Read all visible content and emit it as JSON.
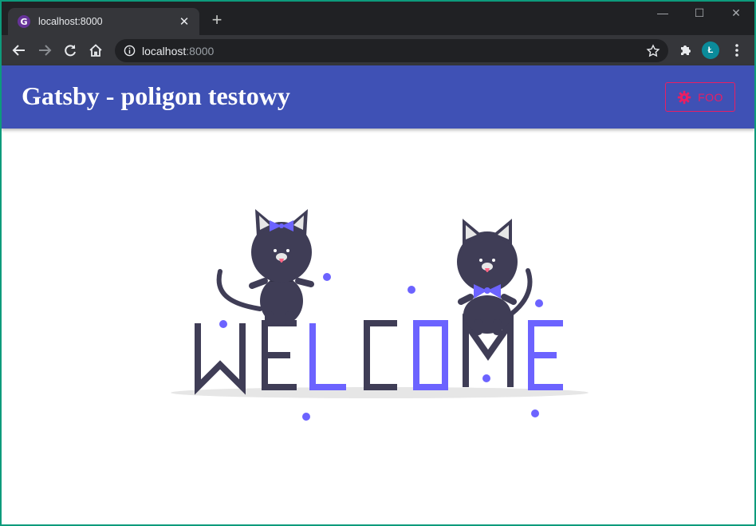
{
  "browser": {
    "tab_title": "localhost:8000",
    "url_host": "localhost",
    "url_port": ":8000",
    "profile_initial": "Ł",
    "icons": {
      "favicon": "gatsby-icon",
      "back": "back-arrow-icon",
      "forward": "forward-arrow-icon",
      "reload": "reload-icon",
      "home": "home-icon",
      "info": "info-icon",
      "bookmark": "star-icon",
      "extensions": "puzzle-icon",
      "menu": "kebab-menu-icon"
    }
  },
  "app": {
    "title": "Gatsby - poligon testowy",
    "foo_button_label": "FOO",
    "foo_button_icon": "settings-gear-icon",
    "colors": {
      "appbar": "#3f51b5",
      "accent": "#e91e63"
    }
  },
  "illustration": {
    "letters": [
      "W",
      "E",
      "L",
      "C",
      "O",
      "M",
      "E"
    ],
    "dark_color": "#3f3d56",
    "accent_color": "#6c63ff"
  }
}
